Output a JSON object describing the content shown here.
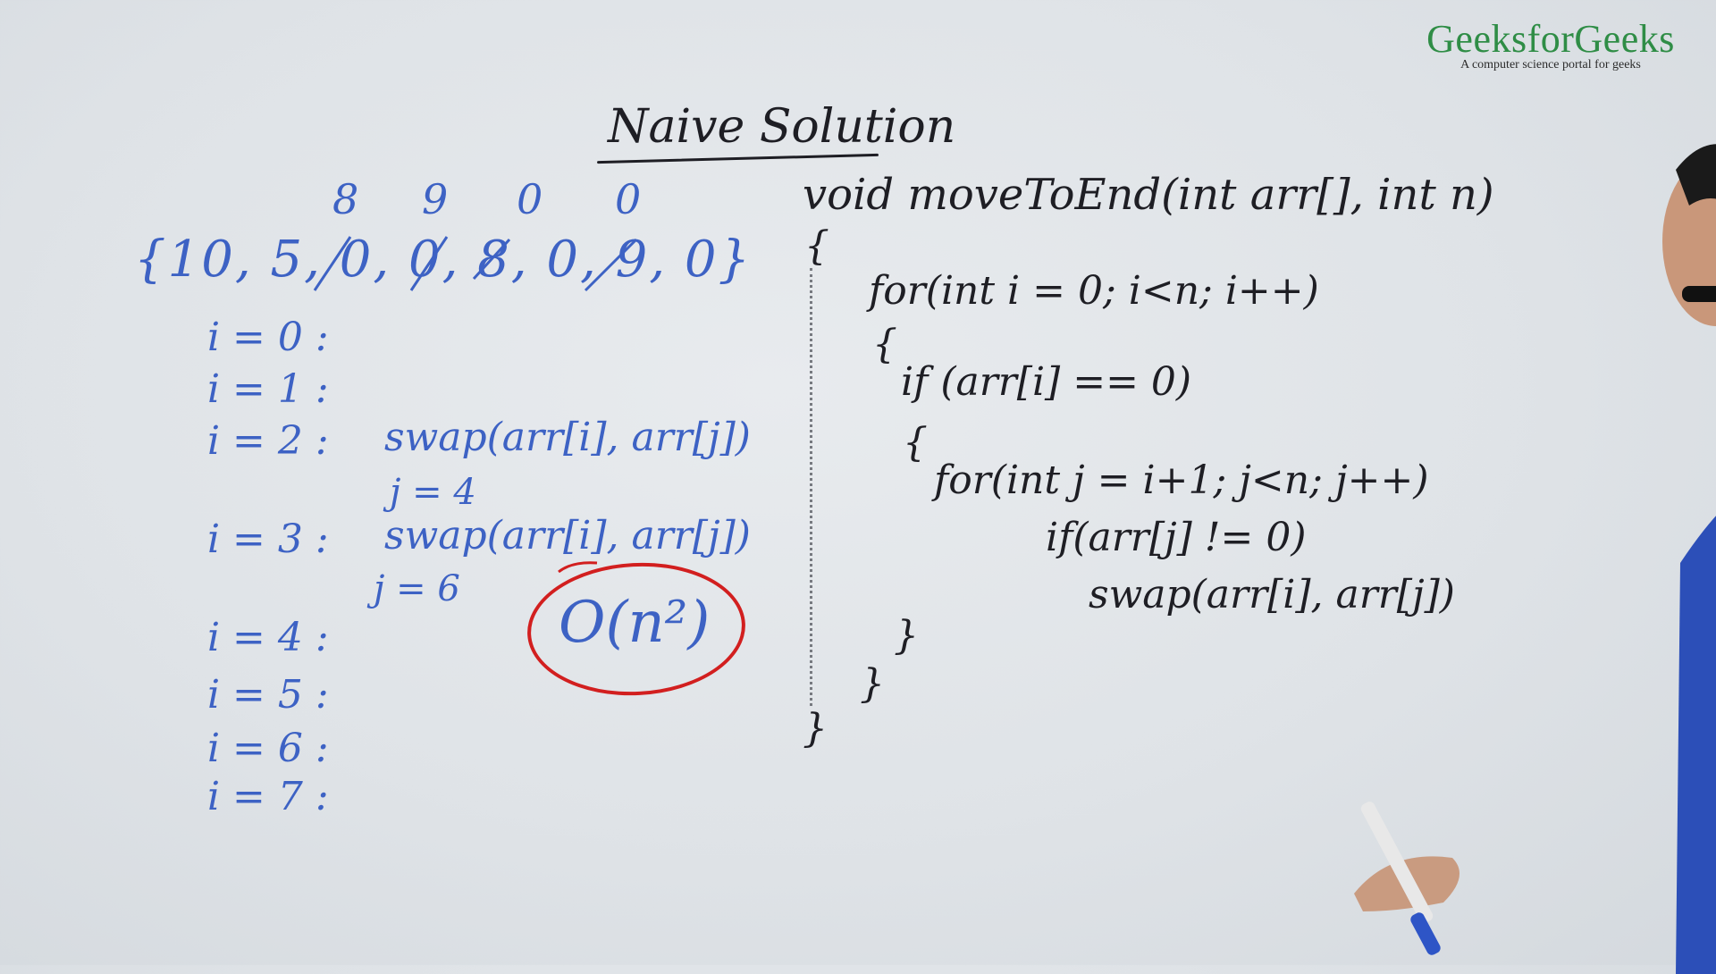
{
  "logo": {
    "title": "GeeksforGeeks",
    "tagline": "A computer science portal for geeks"
  },
  "board": {
    "title": "Naive Solution",
    "top_numbers": [
      "8",
      "9",
      "0",
      "0"
    ],
    "array": "{10, 5, 0, 0, 8, 0, 9, 0}",
    "iterations": [
      {
        "label": "i = 0 :"
      },
      {
        "label": "i = 1 :"
      },
      {
        "label": "i = 2 :",
        "swap": "swap(arr[i], arr[j])",
        "j": "j = 4"
      },
      {
        "label": "i = 3 :",
        "swap": "swap(arr[i], arr[j])",
        "j": "j = 6"
      },
      {
        "label": "i = 4 :"
      },
      {
        "label": "i = 5 :"
      },
      {
        "label": "i = 6 :"
      },
      {
        "label": "i = 7 :"
      }
    ],
    "complexity": "O(n²)",
    "code": [
      "void moveToEnd(int arr[], int n)",
      "{",
      "for(int i = 0; i<n; i++)",
      "{",
      "if (arr[i] == 0)",
      "{",
      "for(int j = i+1; j<n; j++)",
      "if(arr[j] != 0)",
      "swap(arr[i], arr[j])",
      "}",
      "}",
      "}"
    ]
  },
  "colors": {
    "marker_blue": "#3d62c4",
    "marker_black": "#1e1e24",
    "marker_red": "#d21f1f",
    "brand_green": "#2f8d46"
  }
}
